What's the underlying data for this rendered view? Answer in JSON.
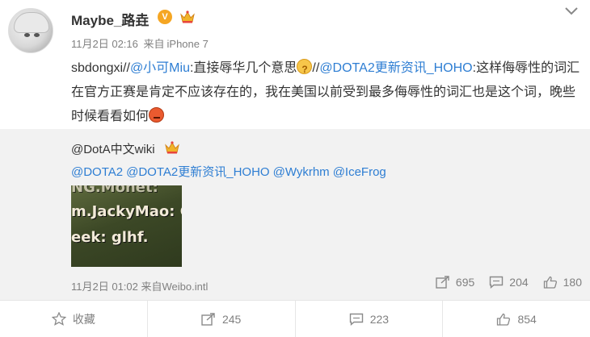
{
  "post": {
    "username": "Maybe_路垚",
    "verified_badge": "V",
    "time": "11月2日 02:16",
    "source_prefix": "来自",
    "source": "iPhone 7",
    "content": {
      "seg1": "sbdongxi//",
      "mention1": "@小可Miu",
      "seg2": ":直接辱华几个意思",
      "sep": "//",
      "mention2": "@DOTA2更新资讯_HOHO",
      "seg3": ":这样侮辱性的词汇在官方正赛是肯定不应该存在的，我在美国以前受到最多侮辱性的词汇也是这个词，晚些时候看看如何"
    }
  },
  "repost": {
    "user": "@DotA中文wiki",
    "mentions": [
      "@DOTA2",
      "@DOTA2更新资讯_HOHO",
      "@Wykrhm",
      "@IceFrog"
    ],
    "thumbnail_lines": [
      "NG.Monet:",
      "m.JackyMao: G",
      "eek: glhf."
    ],
    "time": "11月2日 01:02",
    "source_prefix": "来自",
    "source": "Weibo.intl",
    "stats": {
      "reposts": "695",
      "comments": "204",
      "likes": "180"
    }
  },
  "actions": {
    "favorite": "收藏",
    "repost": "245",
    "comment": "223",
    "like": "854"
  }
}
